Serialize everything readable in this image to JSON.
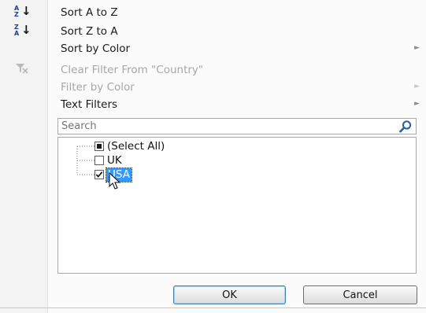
{
  "menu": {
    "sort_az": {
      "label": "Sort A to Z",
      "icon": "sort-ascending-icon",
      "icon_letters": [
        "A",
        "Z"
      ]
    },
    "sort_za": {
      "label": "Sort Z to A",
      "icon": "sort-descending-icon",
      "icon_letters": [
        "Z",
        "A"
      ]
    },
    "sort_by_color": {
      "label": "Sort by Color",
      "arrow": "►"
    },
    "clear_filter": {
      "label": "Clear Filter From \"Country\"",
      "icon": "clear-filter-icon"
    },
    "filter_by_color": {
      "label": "Filter by Color",
      "arrow": "►"
    },
    "text_filters": {
      "label": "Text Filters",
      "arrow": "►"
    }
  },
  "search": {
    "placeholder": "Search",
    "icon": "magnifier-icon"
  },
  "list": {
    "items": [
      {
        "label": "(Select All)",
        "state": "indeterminate"
      },
      {
        "label": "UK",
        "state": "unchecked"
      },
      {
        "label": "USA",
        "state": "checked",
        "selected": true
      }
    ]
  },
  "buttons": {
    "ok": "OK",
    "cancel": "Cancel"
  },
  "colors": {
    "accent": "#3399ff",
    "icon_blue": "#243b8d"
  }
}
